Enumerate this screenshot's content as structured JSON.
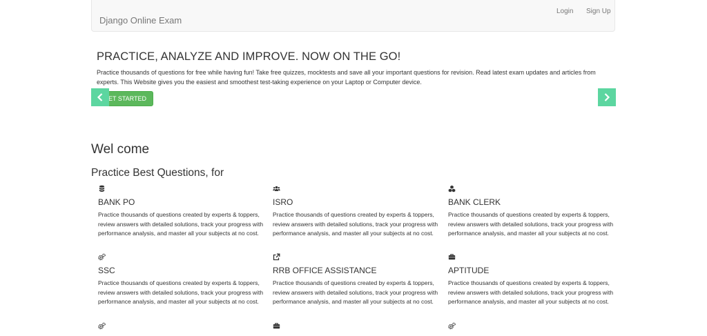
{
  "navbar": {
    "brand": "Django Online Exam",
    "login": "Login",
    "signup": "Sign Up"
  },
  "hero": {
    "title": "PRACTICE, ANALYZE AND IMPROVE. NOW ON THE GO!",
    "text": "Practice thousands of questions for free while having fun! Take free quizzes, mocktests and save all your important questions for revision. Read latest exam updates and articles from experts. This Website gives you the easiest and smoothest test-taking experience on your Laptop or Computer device.",
    "cta": "ET STARTED"
  },
  "welcome": "Wel come",
  "subhead": "Practice Best Questions, for",
  "cards": [
    {
      "icon": "database-icon",
      "title": "BANK PO",
      "text": "Practice thousands of questions created by experts & toppers, review answers with detailed solutions, track your progress with performance analysis, and master all your subjects at no cost."
    },
    {
      "icon": "users-icon",
      "title": "ISRO",
      "text": "Practice thousands of questions created by experts & toppers, review answers with detailed solutions, track your progress with performance analysis, and master all your subjects at no cost."
    },
    {
      "icon": "cubes-icon",
      "title": "BANK CLERK",
      "text": "Practice thousands of questions created by experts & toppers, review answers with detailed solutions, track your progress with performance analysis, and master all your subjects at no cost."
    },
    {
      "icon": "cogs-icon",
      "title": "SSC",
      "text": "Practice thousands of questions created by experts & toppers, review answers with detailed solutions, track your progress with performance analysis, and master all your subjects at no cost."
    },
    {
      "icon": "external-link-icon",
      "title": "RRB OFFICE ASSISTANCE",
      "text": "Practice thousands of questions created by experts & toppers, review answers with detailed solutions, track your progress with performance analysis, and master all your subjects at no cost."
    },
    {
      "icon": "briefcase-icon",
      "title": "APTITUDE",
      "text": "Practice thousands of questions created by experts & toppers, review answers with detailed solutions, track your progress with performance analysis, and master all your subjects at no cost."
    }
  ],
  "bottom_icons": [
    "cogs-icon",
    "briefcase-icon",
    "cogs-icon"
  ]
}
